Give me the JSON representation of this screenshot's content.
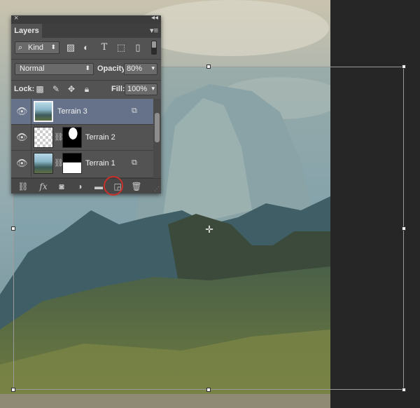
{
  "panel": {
    "title": "Layers",
    "close_glyph": "×",
    "collapse_glyph": "◂◂",
    "menu_glyph": "▾≡",
    "filter": {
      "kind_label": "Kind",
      "icons": [
        "pixel-filter-icon",
        "adjustment-filter-icon",
        "type-filter-icon",
        "shape-filter-icon",
        "smart-object-filter-icon"
      ]
    },
    "blend_mode": "Normal",
    "opacity_label": "Opacity:",
    "opacity_value": "80%",
    "lock_label": "Lock:",
    "fill_label": "Fill:",
    "fill_value": "100%",
    "layers": [
      {
        "name": "Terrain 3",
        "selected": true,
        "smart_object": true
      },
      {
        "name": "Terrain 2",
        "selected": false,
        "smart_object": false,
        "has_mask": true
      },
      {
        "name": "Terrain 1",
        "selected": false,
        "smart_object": true,
        "has_mask": true
      }
    ],
    "bottom_icons": [
      "link-layers-icon",
      "fx-icon",
      "add-mask-icon",
      "new-adjustment-icon",
      "new-group-icon",
      "new-layer-icon",
      "delete-layer-icon"
    ],
    "fx_label": "fx"
  },
  "colors": {
    "panel_bg": "#535353",
    "selected_layer": "#65728a",
    "highlight_circle": "#c8302a"
  }
}
